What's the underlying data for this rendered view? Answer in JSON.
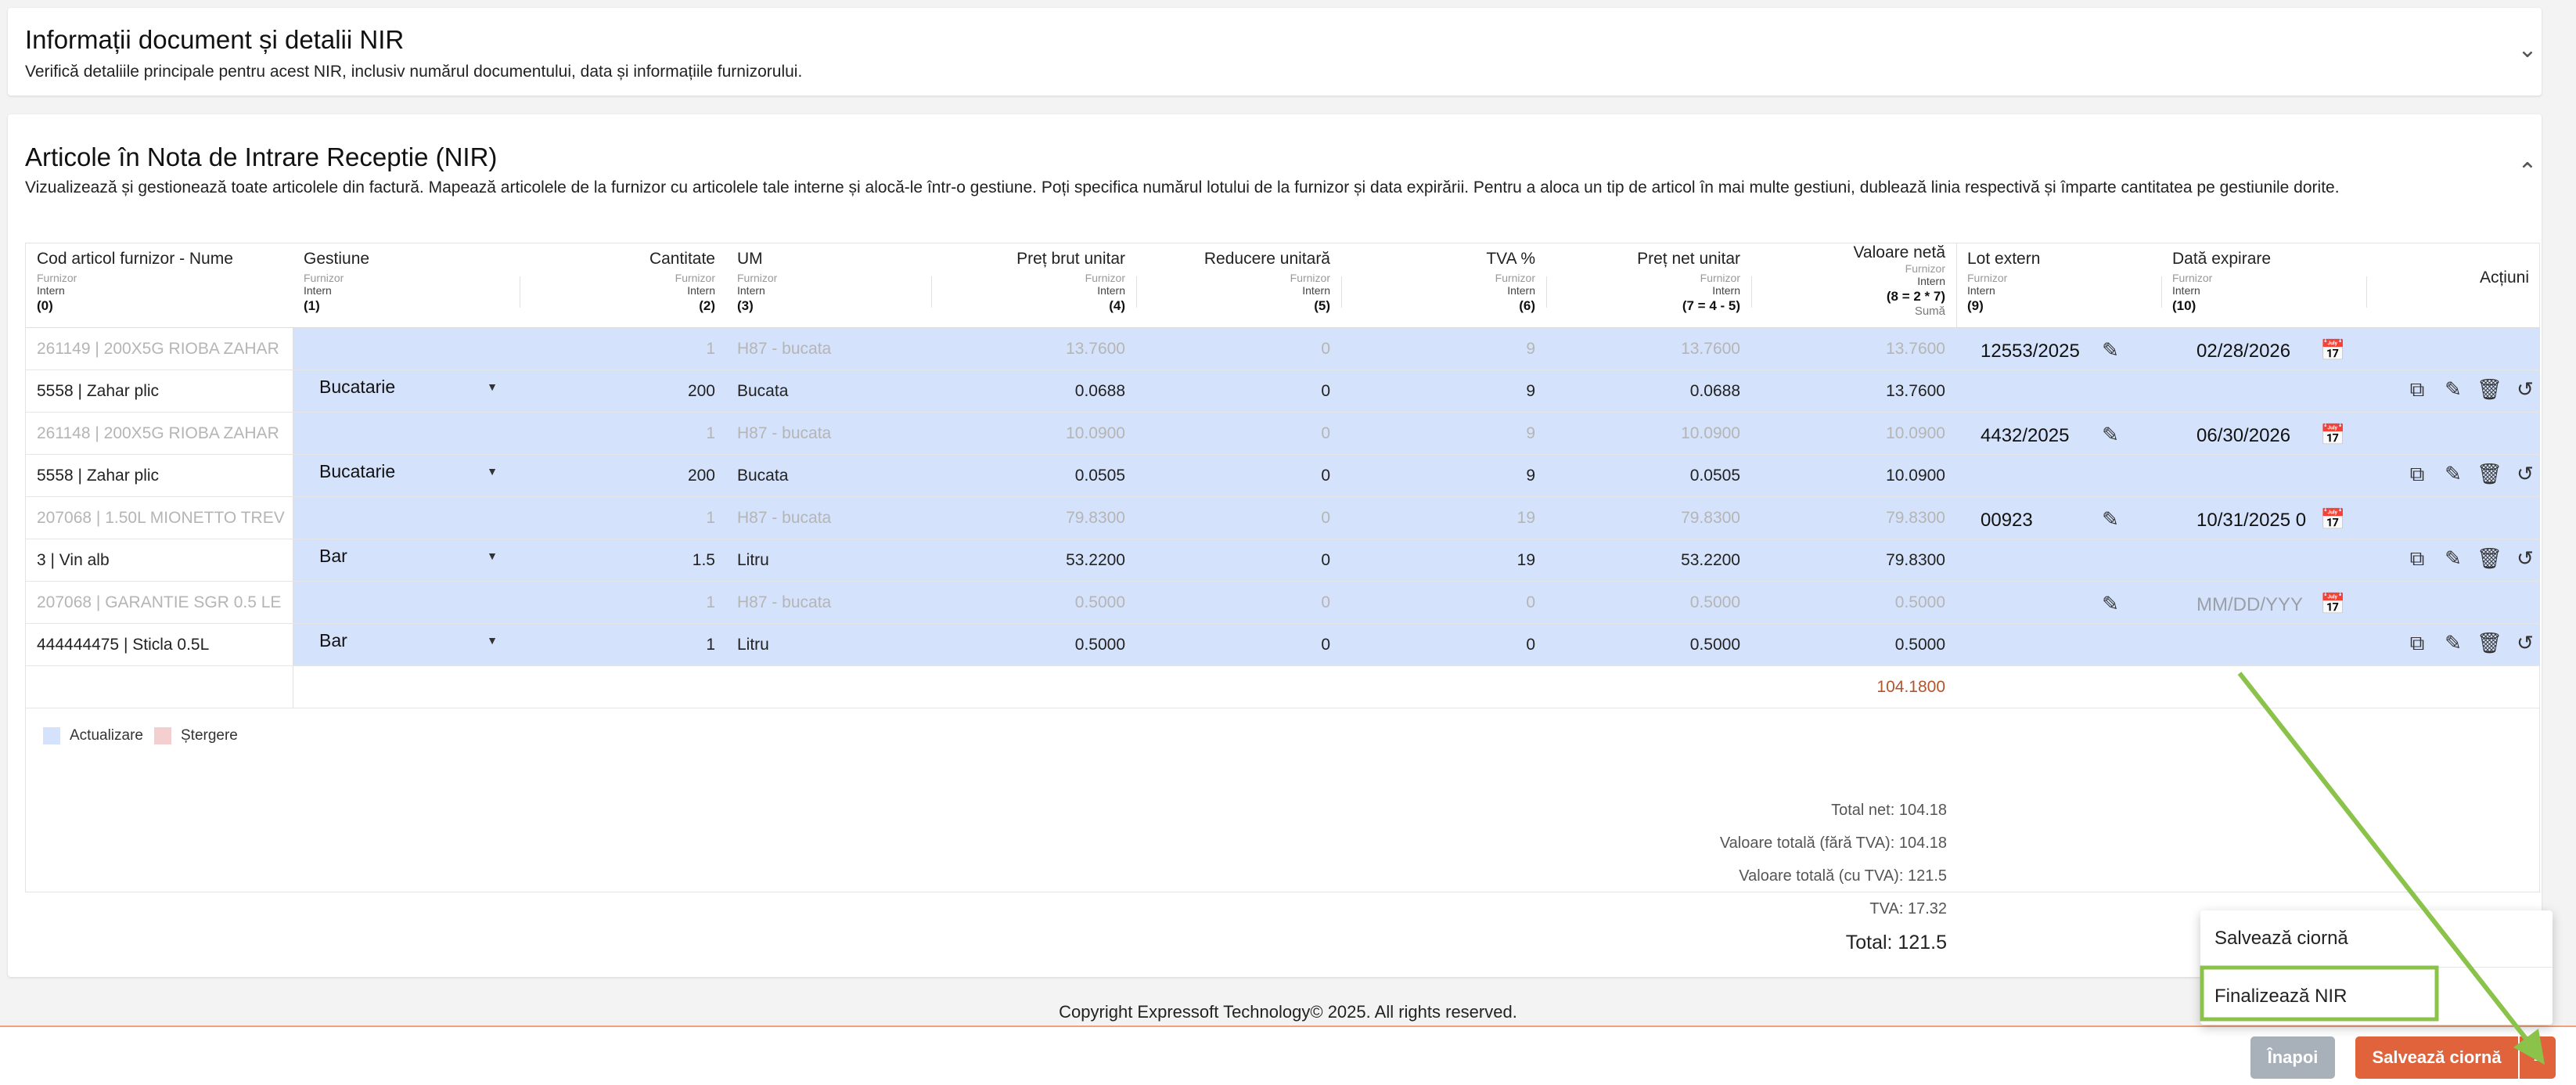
{
  "doc_section": {
    "title": "Informații document și detalii NIR",
    "subtitle": "Verifică detaliile principale pentru acest NIR, inclusiv numărul documentului, data și informațiile furnizorului."
  },
  "articles_section": {
    "title": "Articole în Nota de Intrare Receptie (NIR)",
    "subtitle": "Vizualizează și gestionează toate articolele din factură. Mapează articolele de la furnizor cu articolele tale interne și alocă-le într-o gestiune. Poți specifica numărul lotului de la furnizor și data expirării. Pentru a aloca un tip de articol în mai multe gestiuni, dublează linia respectivă și împarte cantitatea pe gestiunile dorite."
  },
  "columns": [
    {
      "title": "Cod articol furnizor - Nume",
      "sub1": "Furnizor",
      "sub2": "Intern",
      "code": "(0)"
    },
    {
      "title": "Gestiune",
      "sub1": "Furnizor",
      "sub2": "Intern",
      "code": "(1)"
    },
    {
      "title": "Cantitate",
      "sub1": "Furnizor",
      "sub2": "Intern",
      "code": "(2)"
    },
    {
      "title": "UM",
      "sub1": "Furnizor",
      "sub2": "Intern",
      "code": "(3)"
    },
    {
      "title": "Preț brut unitar",
      "sub1": "Furnizor",
      "sub2": "Intern",
      "code": "(4)"
    },
    {
      "title": "Reducere unitară",
      "sub1": "Furnizor",
      "sub2": "Intern",
      "code": "(5)"
    },
    {
      "title": "TVA %",
      "sub1": "Furnizor",
      "sub2": "Intern",
      "code": "(6)"
    },
    {
      "title": "Preț net unitar",
      "sub1": "Furnizor",
      "sub2": "Intern",
      "code": "(7 = 4 - 5)"
    },
    {
      "title": "Valoare netă",
      "sub1": "Furnizor",
      "sub2": "Intern",
      "code": "(8 = 2 * 7)",
      "extra": "Sumă"
    },
    {
      "title": "Lot extern",
      "sub1": "Furnizor",
      "sub2": "Intern",
      "code": "(9)"
    },
    {
      "title": "Dată expirare",
      "sub1": "Furnizor",
      "sub2": "Intern",
      "code": "(10)"
    },
    {
      "title": "Acțiuni"
    }
  ],
  "items": [
    {
      "supplier": {
        "name": "261149 | 200X5G RIOBA ZAHAR",
        "qty": "1",
        "um": "H87 - bucata",
        "price": "13.7600",
        "disc": "0",
        "vat": "9",
        "net": "13.7600",
        "value": "13.7600"
      },
      "internal": {
        "name": "5558 | Zahar plic",
        "gestiune": "Bucatarie",
        "qty": "200",
        "um": "Bucata",
        "price": "0.0688",
        "disc": "0",
        "vat": "9",
        "net": "0.0688",
        "value": "13.7600"
      },
      "lot": "12553/2025",
      "expiry": "02/28/2026"
    },
    {
      "supplier": {
        "name": "261148 | 200X5G RIOBA ZAHAR",
        "qty": "1",
        "um": "H87 - bucata",
        "price": "10.0900",
        "disc": "0",
        "vat": "9",
        "net": "10.0900",
        "value": "10.0900"
      },
      "internal": {
        "name": "5558 | Zahar plic",
        "gestiune": "Bucatarie",
        "qty": "200",
        "um": "Bucata",
        "price": "0.0505",
        "disc": "0",
        "vat": "9",
        "net": "0.0505",
        "value": "10.0900"
      },
      "lot": "4432/2025",
      "expiry": "06/30/2026"
    },
    {
      "supplier": {
        "name": "207068 | 1.50L MIONETTO TREV",
        "qty": "1",
        "um": "H87 - bucata",
        "price": "79.8300",
        "disc": "0",
        "vat": "19",
        "net": "79.8300",
        "value": "79.8300"
      },
      "internal": {
        "name": "3 | Vin alb",
        "gestiune": "Bar",
        "qty": "1.5",
        "um": "Litru",
        "price": "53.2200",
        "disc": "0",
        "vat": "19",
        "net": "53.2200",
        "value": "79.8300"
      },
      "lot": "00923",
      "expiry": "10/31/2025 0"
    },
    {
      "supplier": {
        "name": "207068 | GARANTIE SGR 0.5 LE",
        "qty": "1",
        "um": "H87 - bucata",
        "price": "0.5000",
        "disc": "0",
        "vat": "0",
        "net": "0.5000",
        "value": "0.5000"
      },
      "internal": {
        "name": "444444475 | Sticla 0.5L",
        "gestiune": "Bar",
        "qty": "1",
        "um": "Litru",
        "price": "0.5000",
        "disc": "0",
        "vat": "0",
        "net": "0.5000",
        "value": "0.5000"
      },
      "lot": "",
      "expiry": "",
      "expiry_placeholder": "MM/DD/YYY"
    }
  ],
  "table_total": "104.1800",
  "legend": {
    "update": "Actualizare",
    "delete": "Ștergere",
    "update_color": "#d4e2fb",
    "delete_color": "#f4cfcf"
  },
  "summary": {
    "net": "Total net: 104.18",
    "no_vat": "Valoare totală (fără TVA): 104.18",
    "with_vat": "Valoare totală (cu TVA): 121.5",
    "vat": "TVA: 17.32",
    "total": "Total: 121.5"
  },
  "footer": "Copyright Expressoft Technology© 2025. All rights reserved.",
  "menu": {
    "save_draft": "Salvează ciornă",
    "finalize": "Finalizează NIR"
  },
  "buttons": {
    "back": "Înapoi",
    "save": "Salvează ciornă"
  },
  "icons": {
    "expand": "chevron-down-icon",
    "collapse": "chevron-up-icon",
    "edit": "pencil-icon",
    "calendar": "calendar-icon",
    "copy": "copy-icon",
    "delete": "trash-icon",
    "history": "history-icon"
  },
  "colors": {
    "accent": "#e0633b",
    "total_value": "#b5532b",
    "annotation": "#8bc34a"
  }
}
